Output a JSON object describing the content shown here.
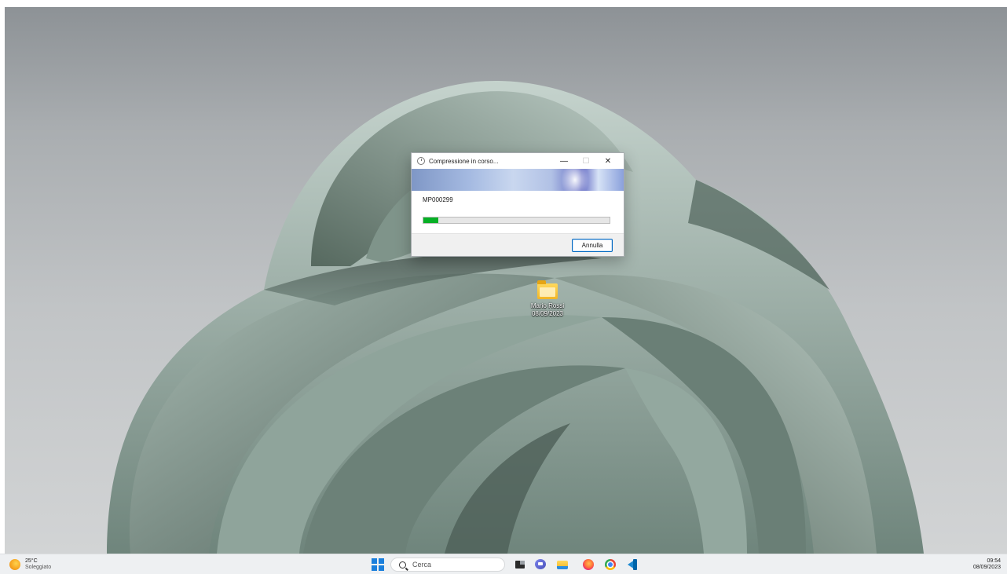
{
  "dialog": {
    "title": "Compressione in corso...",
    "minimize_glyph": "—",
    "maximize_glyph": "☐",
    "close_glyph": "✕",
    "file_name": "MP000299",
    "progress_percent": 8,
    "progress_color": "#06b025",
    "cancel_label": "Annulla"
  },
  "desktop": {
    "icon": {
      "icon_name": "folder-icon",
      "label_line1": "Mario Rossi",
      "label_line2": "08/09/2023"
    }
  },
  "taskbar": {
    "weather": {
      "icon_name": "sun-icon",
      "temperature": "25°C",
      "description": "Soleggiato"
    },
    "search_placeholder": "Cerca",
    "apps": [
      "task-view-icon",
      "chat-icon",
      "file-explorer-icon",
      "firefox-icon",
      "chrome-icon",
      "vscode-icon"
    ],
    "clock": {
      "time": "09:54",
      "date": "08/09/2023"
    },
    "accent_color": "#1a7fdc"
  }
}
